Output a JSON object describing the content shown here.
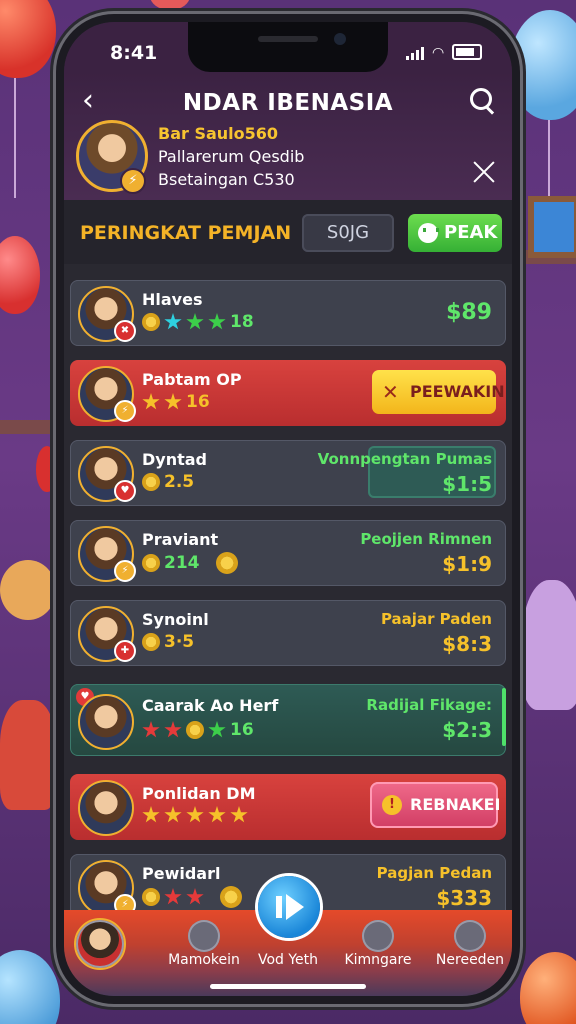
{
  "status": {
    "time": "8:41"
  },
  "header": {
    "title": "NDAR IBENASIA"
  },
  "profile": {
    "name": "Bar Saulo560",
    "line1": "Pallarerum Qesdib",
    "line2": "Bsetaingan C530"
  },
  "section": {
    "title": "PERINGKAT PEMJAN",
    "box": "S0JG",
    "peak_label": "PEAK"
  },
  "rows": [
    {
      "name": "Hlaves",
      "stat": "18",
      "amount": "$89"
    },
    {
      "name": "Pabtam OP",
      "stat": "16",
      "button": "PEEWAKIN"
    },
    {
      "name": "Dyntad",
      "stat": "2.5",
      "label": "Vonnpengtan Pumas",
      "amount": "$1:5"
    },
    {
      "name": "Praviant",
      "stat": "214",
      "label": "Peojjen Rimnen",
      "amount": "$1:9"
    },
    {
      "name": "Synoinl",
      "stat": "3·5",
      "label": "Paajar Paden",
      "amount": "$8:3"
    },
    {
      "name": "Caarak Ao Herf",
      "stat": "16",
      "label": "Radijal Fikage:",
      "amount": "$2:3"
    },
    {
      "name": "Ponlidan DM",
      "button": "REBNAKEI"
    },
    {
      "name": "Pewidarl",
      "label": "Pagjan Pedan",
      "amount": "$333"
    }
  ],
  "tabs": {
    "tab2": "Mamokein",
    "tab3": "Vod Yeth",
    "tab4": "Kimngare",
    "tab5": "Nereeden"
  },
  "colors": {
    "accent_gold": "#f6c12a",
    "accent_green": "#5fe66a",
    "red_row": "#d8423e"
  }
}
